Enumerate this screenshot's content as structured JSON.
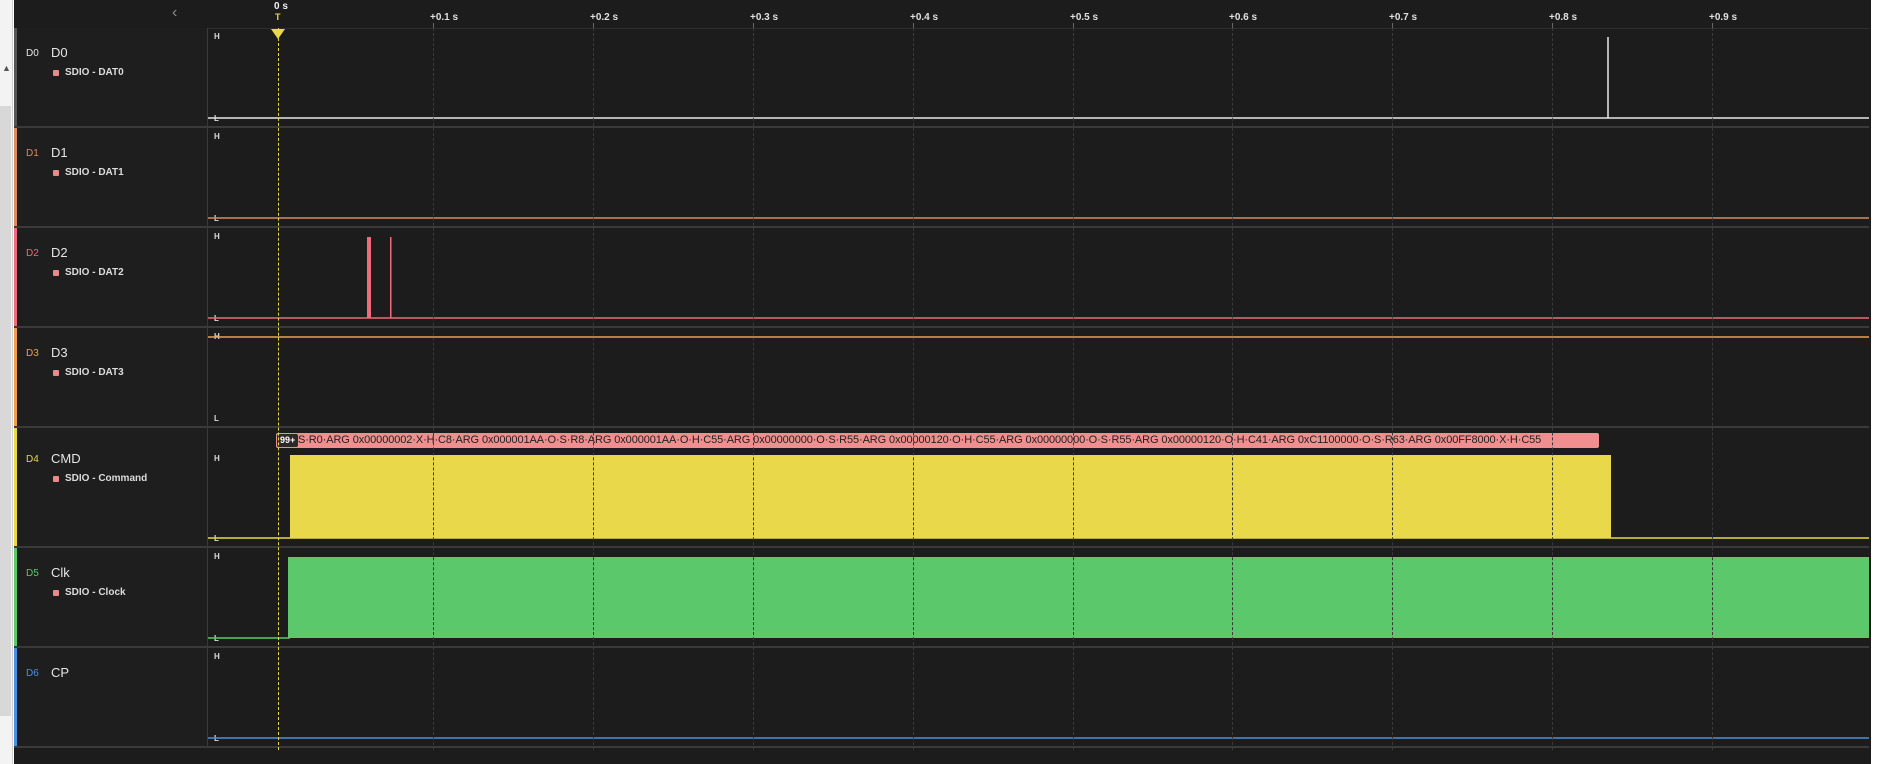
{
  "ruler": {
    "trigger_time": "0 s",
    "trigger_flag": "T",
    "ticks": [
      "+0.1 s",
      "+0.2 s",
      "+0.3 s",
      "+0.4 s",
      "+0.5 s",
      "+0.6 s",
      "+0.7 s",
      "+0.8 s",
      "+0.9 s"
    ]
  },
  "level_labels": {
    "high": "H",
    "low": "L"
  },
  "channels": [
    {
      "id": "D0",
      "name": "D0",
      "color": "#e6e6e6",
      "analyzer": "SDIO - DAT0"
    },
    {
      "id": "D1",
      "name": "D1",
      "color": "#d98c5f",
      "analyzer": "SDIO - DAT1"
    },
    {
      "id": "D2",
      "name": "D2",
      "color": "#ef6a7a",
      "analyzer": "SDIO - DAT2"
    },
    {
      "id": "D3",
      "name": "D3",
      "color": "#f0a04b",
      "analyzer": "SDIO - DAT3"
    },
    {
      "id": "D4",
      "name": "CMD",
      "color": "#e9d84a",
      "analyzer": "SDIO - Command"
    },
    {
      "id": "D5",
      "name": "Clk",
      "color": "#5bc96b",
      "analyzer": "SDIO - Clock"
    },
    {
      "id": "D6",
      "name": "CP",
      "color": "#4a90e2",
      "analyzer": ""
    }
  ],
  "decode": {
    "count_badge": "99+",
    "text": "S·R0·ARG 0x00000002·X·H·C8·ARG 0x000001AA·O·S·R8·ARG 0x000001AA·O·H·C55·ARG 0x00000000·O·S·R55·ARG 0x00000120·O·H·C55·ARG 0x00000000·O·S·R55·ARG 0x00000120·O·H·C41·ARG 0xC1100000·O·S·R63·ARG 0x00FF8000·X·H·C55"
  },
  "colors": {
    "background": "#1c1c1c",
    "trigger": "#e9d84a",
    "decode": "#ef8f8f"
  },
  "icons": {
    "collapse": "chevron-left-icon",
    "trigger": "trigger-marker-icon"
  }
}
